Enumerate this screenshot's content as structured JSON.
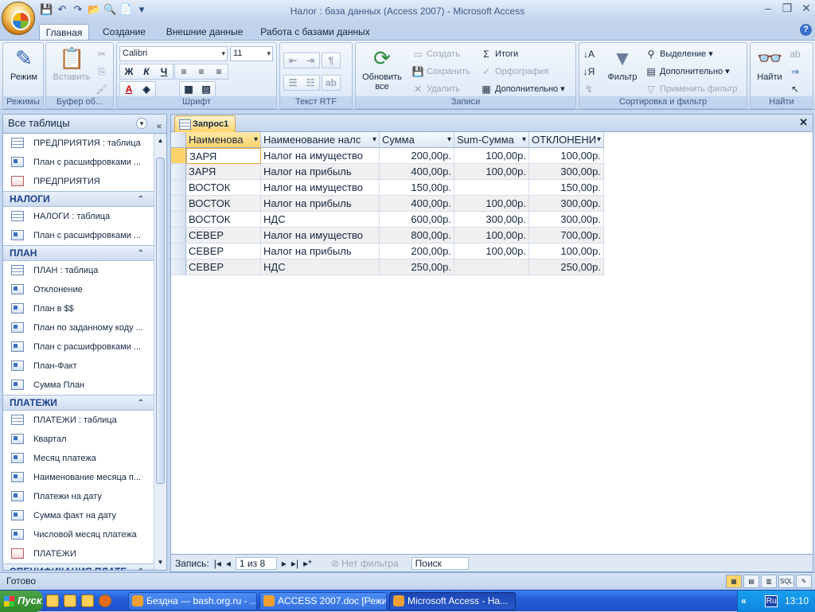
{
  "window": {
    "title": "Налог : база данных (Access 2007) - Microsoft Access"
  },
  "ribbon_tabs": [
    "Главная",
    "Создание",
    "Внешние данные",
    "Работа с базами данных"
  ],
  "ribbon": {
    "views": {
      "button": "Режим",
      "label": "Режимы"
    },
    "clipboard": {
      "paste": "Вставить",
      "label": "Буфер об..."
    },
    "font": {
      "name": "Calibri",
      "size": "11",
      "bold": "Ж",
      "italic": "К",
      "underline": "Ч",
      "label": "Шрифт"
    },
    "rtf": {
      "label": "Текст RTF"
    },
    "records": {
      "refresh": "Обновить все",
      "new": "Создать",
      "save": "Сохранить",
      "delete": "Удалить",
      "totals": "Итоги",
      "spelling": "Орфография",
      "more": "Дополнительно",
      "label": "Записи"
    },
    "sort": {
      "filter": "Фильтр",
      "selection": "Выделение",
      "advanced": "Дополнительно",
      "toggle": "Применить фильтр",
      "label": "Сортировка и фильтр"
    },
    "find": {
      "find": "Найти",
      "label": "Найти"
    }
  },
  "nav": {
    "header": "Все таблицы",
    "items": [
      {
        "type": "item",
        "icon": "t",
        "label": "ПРЕДПРИЯТИЯ : таблица"
      },
      {
        "type": "item",
        "icon": "q",
        "label": "План с расшифровками ..."
      },
      {
        "type": "item",
        "icon": "f",
        "label": "ПРЕДПРИЯТИЯ"
      },
      {
        "type": "group",
        "label": "НАЛОГИ"
      },
      {
        "type": "item",
        "icon": "t",
        "label": "НАЛОГИ : таблица"
      },
      {
        "type": "item",
        "icon": "q",
        "label": "План с расшифровками ..."
      },
      {
        "type": "group",
        "label": "ПЛАН"
      },
      {
        "type": "item",
        "icon": "t",
        "label": "ПЛАН : таблица"
      },
      {
        "type": "item",
        "icon": "q",
        "label": "Отклонение"
      },
      {
        "type": "item",
        "icon": "q",
        "label": "План в $$"
      },
      {
        "type": "item",
        "icon": "q",
        "label": "План по заданному коду ..."
      },
      {
        "type": "item",
        "icon": "q",
        "label": "План с расшифровками ..."
      },
      {
        "type": "item",
        "icon": "q",
        "label": "План-Факт"
      },
      {
        "type": "item",
        "icon": "q",
        "label": "Сумма План"
      },
      {
        "type": "group",
        "label": "ПЛАТЕЖИ"
      },
      {
        "type": "item",
        "icon": "t",
        "label": "ПЛАТЕЖИ : таблица"
      },
      {
        "type": "item",
        "icon": "q",
        "label": "Квартал"
      },
      {
        "type": "item",
        "icon": "q",
        "label": "Месяц платежа"
      },
      {
        "type": "item",
        "icon": "q",
        "label": "Наименование месяца п..."
      },
      {
        "type": "item",
        "icon": "q",
        "label": "Платежи на дату"
      },
      {
        "type": "item",
        "icon": "q",
        "label": "Сумма факт на дату"
      },
      {
        "type": "item",
        "icon": "q",
        "label": "Числовой месяц платежа"
      },
      {
        "type": "item",
        "icon": "f",
        "label": "ПЛАТЕЖИ"
      },
      {
        "type": "group",
        "label": "СПЕЦИФИКАЦИЯ ПЛАТЕ..."
      }
    ]
  },
  "document": {
    "tab": "Запрос1",
    "columns": [
      "Наименова",
      "Наименование налс",
      "Сумма",
      "Sum-Сумма",
      "ОТКЛОНЕНИ"
    ],
    "rows": [
      [
        "ЗАРЯ",
        "Налог на имущество",
        "200,00р.",
        "100,00р.",
        "100,00р."
      ],
      [
        "ЗАРЯ",
        "Налог на прибыль",
        "400,00р.",
        "100,00р.",
        "300,00р."
      ],
      [
        "ВОСТОК",
        "Налог на имущество",
        "150,00р.",
        "",
        "150,00р."
      ],
      [
        "ВОСТОК",
        "Налог на прибыль",
        "400,00р.",
        "100,00р.",
        "300,00р."
      ],
      [
        "ВОСТОК",
        "НДС",
        "600,00р.",
        "300,00р.",
        "300,00р."
      ],
      [
        "СЕВЕР",
        "Налог на имущество",
        "800,00р.",
        "100,00р.",
        "700,00р."
      ],
      [
        "СЕВЕР",
        "Налог на прибыль",
        "200,00р.",
        "100,00р.",
        "100,00р."
      ],
      [
        "СЕВЕР",
        "НДС",
        "250,00р.",
        "",
        "250,00р."
      ]
    ],
    "record_nav": {
      "label": "Запись:",
      "position": "1 из 8",
      "filter": "Нет фильтра",
      "search": "Поиск"
    }
  },
  "status": {
    "text": "Готово",
    "sql": "SQL"
  },
  "taskbar": {
    "start": "Пуск",
    "tasks": [
      "Бездна — bash.org.ru - ...",
      "ACCESS 2007.doc [Режи...",
      "Microsoft Access - На..."
    ],
    "lang": "Ru",
    "clock": "13:10"
  }
}
